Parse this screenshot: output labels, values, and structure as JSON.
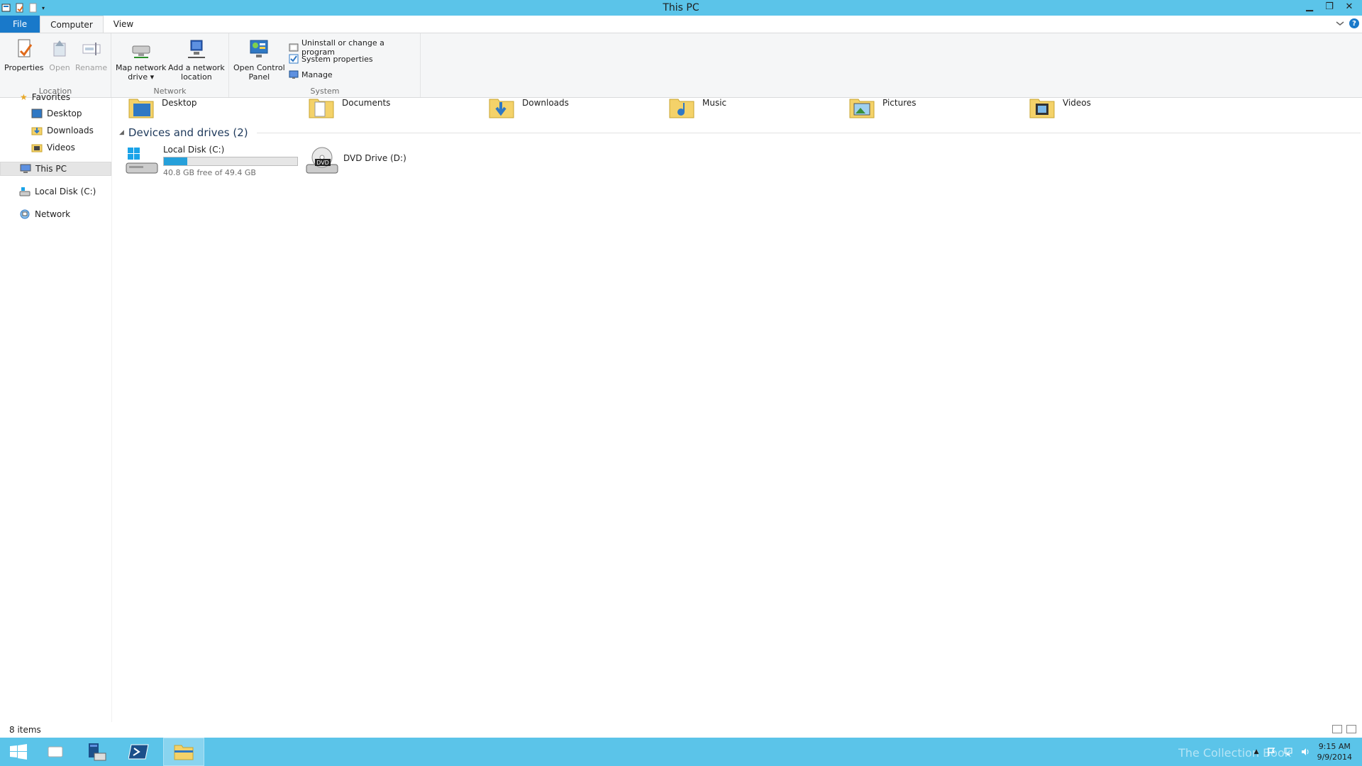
{
  "window": {
    "title": "This PC"
  },
  "tabs": [
    {
      "label": "File"
    },
    {
      "label": "Computer"
    },
    {
      "label": "View"
    }
  ],
  "ribbon": {
    "location": {
      "group_label": "Location",
      "properties": "Properties",
      "open": "Open",
      "rename": "Rename"
    },
    "network": {
      "group_label": "Network",
      "map_network_drive_line1": "Map network",
      "map_network_drive_line2": "drive",
      "add_network_location_line1": "Add a network",
      "add_network_location_line2": "location"
    },
    "system": {
      "group_label": "System",
      "open_control_panel_line1": "Open Control",
      "open_control_panel_line2": "Panel",
      "uninstall": "Uninstall or change a program",
      "system_properties": "System properties",
      "manage": "Manage"
    }
  },
  "nav": {
    "favorites": "Favorites",
    "items": [
      {
        "label": "Desktop"
      },
      {
        "label": "Downloads"
      },
      {
        "label": "Videos"
      }
    ],
    "this_pc": "This PC",
    "local_disk": "Local Disk (C:)",
    "network": "Network"
  },
  "folders": [
    {
      "label": "Desktop",
      "icon": "desktop-folder-icon"
    },
    {
      "label": "Documents",
      "icon": "documents-folder-icon"
    },
    {
      "label": "Downloads",
      "icon": "downloads-folder-icon"
    },
    {
      "label": "Music",
      "icon": "music-folder-icon"
    },
    {
      "label": "Pictures",
      "icon": "pictures-folder-icon"
    },
    {
      "label": "Videos",
      "icon": "videos-folder-icon"
    }
  ],
  "devices": {
    "header": "Devices and drives (2)",
    "local_disk": {
      "label": "Local Disk (C:)",
      "free_text": "40.8 GB free of 49.4 GB",
      "used_fraction": 0.174
    },
    "dvd": {
      "label": "DVD Drive (D:)",
      "badge": "DVD"
    }
  },
  "status": {
    "items": "8 items"
  },
  "taskbar": {
    "time": "9:15 AM",
    "date": "9/9/2014",
    "watermark": "The Collection Book"
  },
  "colors": {
    "accent": "#5bc4e9",
    "file_tab": "#1979ca",
    "drive_bar": "#26a0da"
  }
}
